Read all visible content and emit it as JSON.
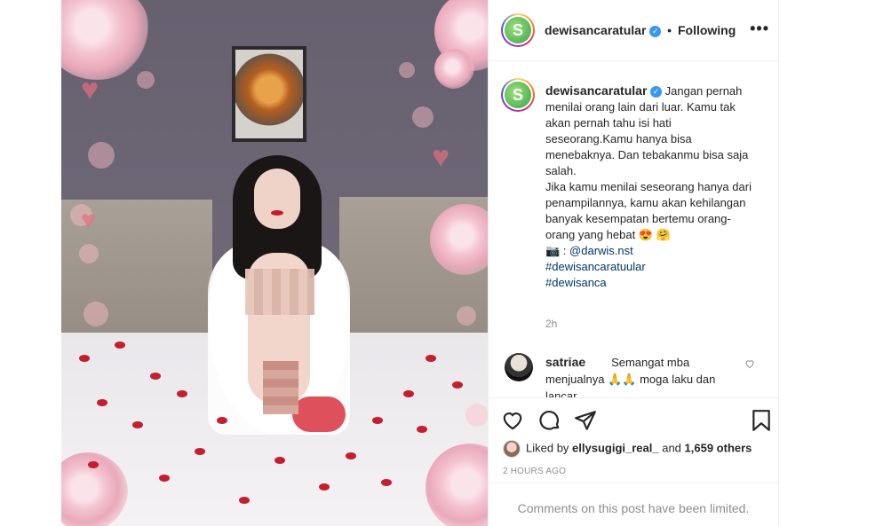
{
  "post": {
    "username": "dewisancaratular",
    "verified_mark": "✓",
    "separator": "•",
    "follow_status": "Following",
    "more_label": "•••"
  },
  "caption": {
    "username": "dewisancaratular",
    "paragraph1": "Jangan pernah menilai orang lain dari luar. Kamu tak akan pernah tahu isi hati seseorang.Kamu hanya bisa menebaknya. Dan tebakanmu bisa saja salah.",
    "paragraph2": "Jika kamu menilai seseorang hanya dari penampilannya, kamu akan kehilangan banyak kesempatan bertemu orang-orang yang hebat 😍 🤗",
    "credit_prefix": "📷 : ",
    "credit_handle": "@darwis.nst",
    "hashtag1": "#dewisancaratuular",
    "hashtag2": "#dewisanca",
    "time": "2h"
  },
  "comment": {
    "username": "satriae",
    "text": "Semangat mba menjualnya 🙏🙏 moga laku dan lancar",
    "like_icon": "heart-outline-icon"
  },
  "actions": {
    "icons": [
      "heart-outline-icon",
      "comment-icon",
      "share-icon",
      "bookmark-icon"
    ],
    "liked_by_prefix": "Liked by ",
    "liked_by_user": "ellysugigi_real_",
    "liked_by_mid": " and ",
    "liked_by_count": "1,659 others",
    "timestamp": "2 HOURS AGO"
  },
  "footer": {
    "limited_text": "Comments on this post have been limited."
  },
  "colors": {
    "link": "#00376b",
    "secondary_text": "#8e8e8e",
    "verified": "#3897f0",
    "border": "#efefef"
  }
}
